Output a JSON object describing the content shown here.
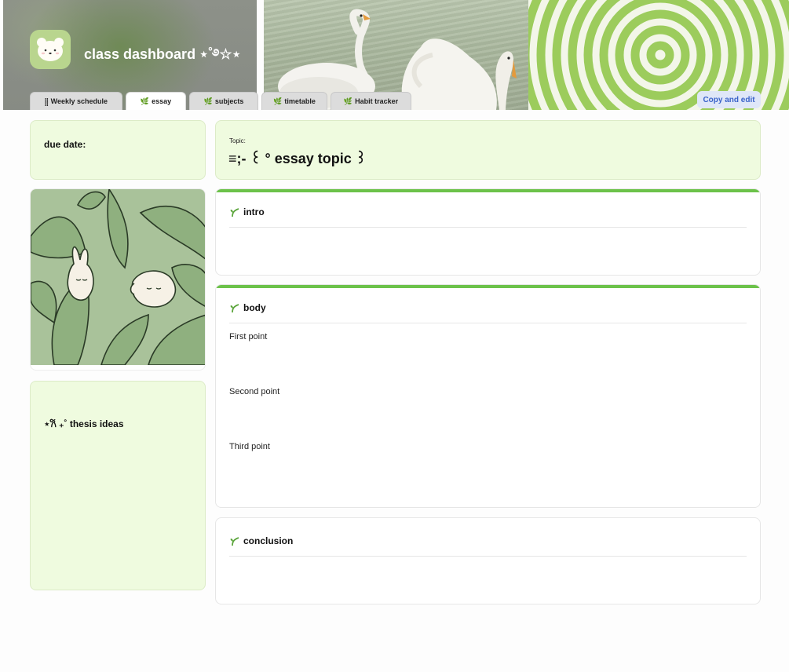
{
  "header": {
    "title": "class dashboard ⋆˚࿔☆⋆",
    "avatar_icon": "bear-face-icon",
    "tabs": [
      {
        "label": "Weekly schedule",
        "prefix": "⸽⸽",
        "active": false
      },
      {
        "label": "essay",
        "prefix": "🌿",
        "active": true
      },
      {
        "label": "subjects",
        "prefix": "🌿",
        "active": false
      },
      {
        "label": "timetable",
        "prefix": "🌿",
        "active": false
      },
      {
        "label": "Habit tracker",
        "prefix": "🌿",
        "active": false
      }
    ],
    "copy_button": "Copy and edit"
  },
  "due": {
    "label": "due date:"
  },
  "topic": {
    "small": "Topic:",
    "title": "≡;- ꒰ ° essay topic ꒱"
  },
  "thesis": {
    "label": "⋆𐙚 ₊˚ thesis ideas"
  },
  "sections": {
    "intro": {
      "label": "intro"
    },
    "body": {
      "label": "body",
      "points": [
        "First point",
        "Second point",
        "Third point"
      ]
    },
    "conclusion": {
      "label": "conclusion"
    }
  },
  "colors": {
    "accent": "#6cc24a",
    "card_bg": "#effbdf",
    "button_bg": "#dfe7f8",
    "button_text": "#3a63c9"
  }
}
